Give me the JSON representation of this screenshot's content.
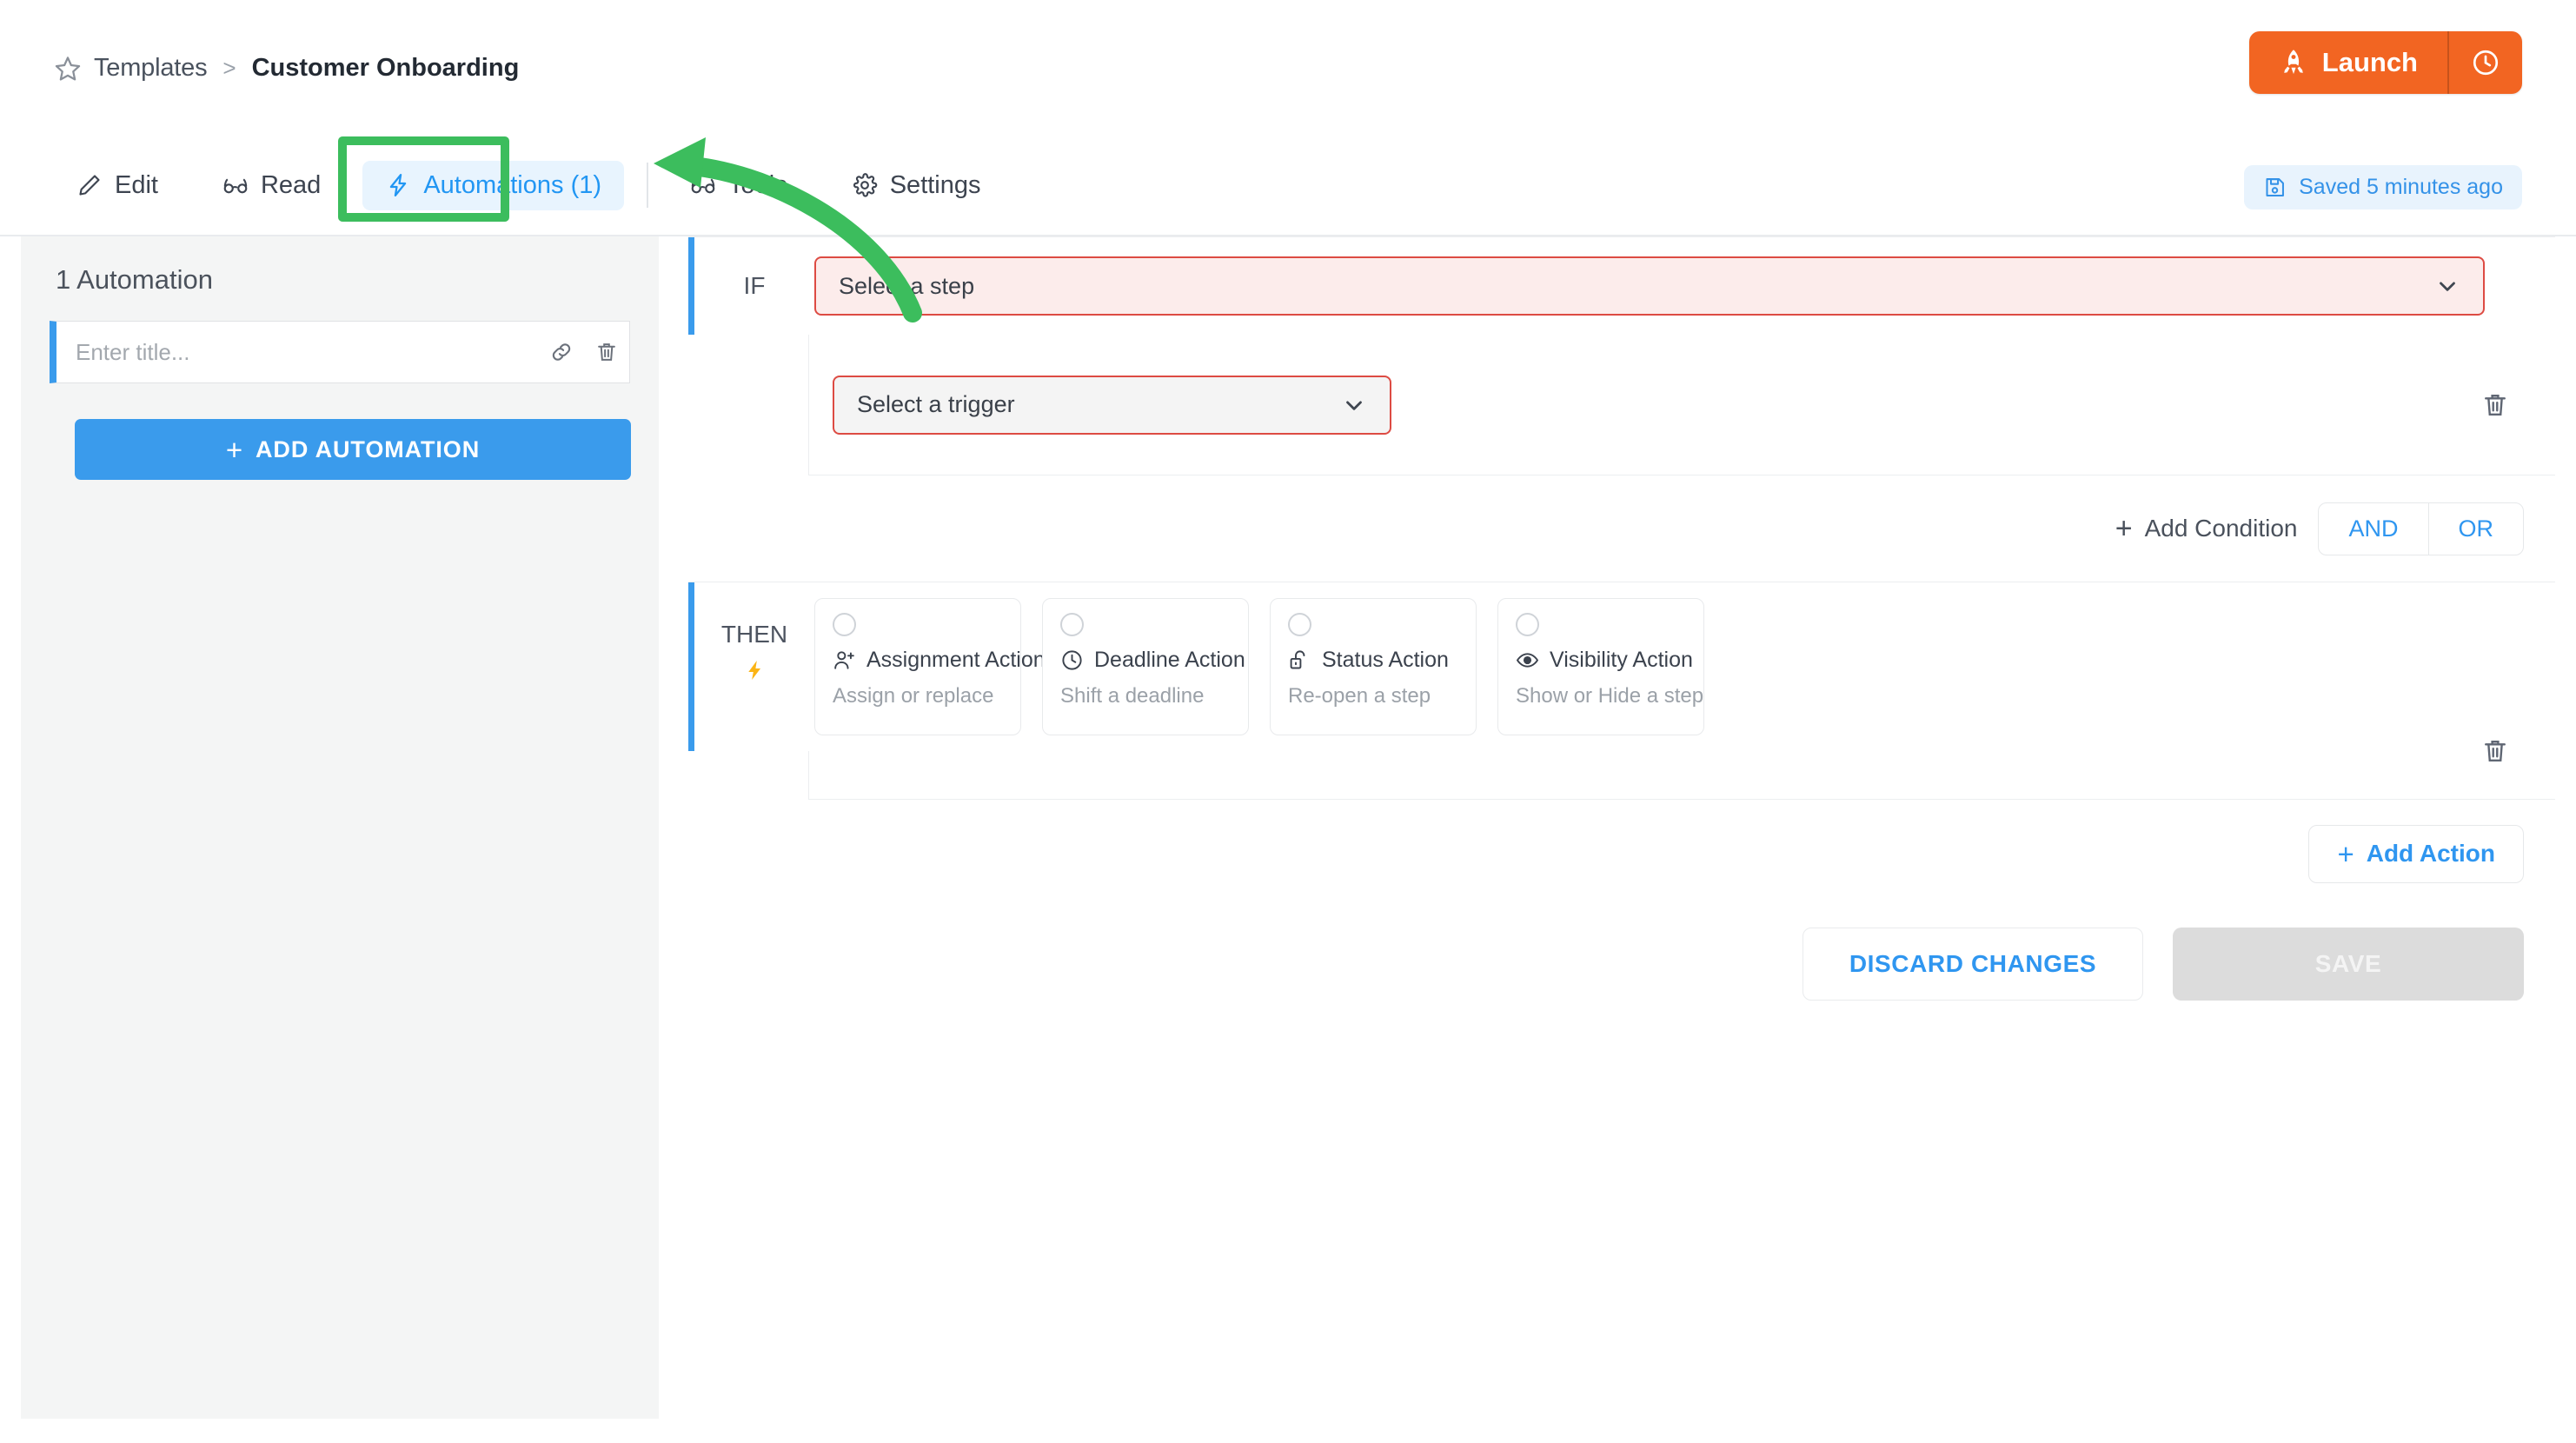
{
  "header": {
    "breadcrumb": {
      "star_icon": "star-icon",
      "root": "Templates",
      "separator": ">",
      "current": "Customer Onboarding"
    },
    "launch": {
      "label": "Launch",
      "rocket_icon": "rocket-icon",
      "clock_icon": "clock-icon",
      "color": "#f26522"
    }
  },
  "tabs": {
    "items": [
      {
        "label": "Edit",
        "icon": "pencil-icon",
        "active": false
      },
      {
        "label": "Read",
        "icon": "glasses-icon",
        "active": false
      },
      {
        "label": "Automations (1)",
        "icon": "bolt-icon",
        "active": true
      },
      {
        "label": "Tools",
        "icon": "glasses-icon",
        "active": false
      },
      {
        "label": "Settings",
        "icon": "gear-icon",
        "active": false
      }
    ],
    "saved_badge": {
      "label": "Saved 5 minutes ago",
      "icon": "save-disk-icon",
      "color": "#3492e8"
    }
  },
  "sidebar": {
    "title": "1 Automation",
    "automation_item": {
      "title_value": "",
      "title_placeholder": "Enter title...",
      "link_icon": "link-icon",
      "delete_icon": "trash-icon",
      "accent_color": "#3a9bec"
    },
    "add_button": {
      "label": "ADD AUTOMATION",
      "plus": "+",
      "color": "#3a9bec"
    }
  },
  "editor": {
    "if": {
      "label": "IF",
      "step_dropdown": {
        "value": "Select a step",
        "error": true,
        "fill": "#fceceb",
        "border": "#dd4b43",
        "chevron_icon": "chevron-down-icon"
      },
      "trigger_dropdown": {
        "value": "Select a trigger",
        "error": true,
        "fill": "#f4f4f4",
        "border": "#dd4b43",
        "chevron_icon": "chevron-down-icon"
      },
      "delete_icon": "trash-icon"
    },
    "condition_row": {
      "add_condition_label": "Add Condition",
      "plus": "+",
      "and_label": "AND",
      "or_label": "OR",
      "accent": "#2f96f0"
    },
    "then": {
      "label": "THEN",
      "bolt_icon": "lightning-bolt-icon",
      "actions": [
        {
          "title": "Assignment Action",
          "subtitle": "Assign or replace",
          "icon": "user-plus-icon",
          "selected": false
        },
        {
          "title": "Deadline Action",
          "subtitle": "Shift a deadline",
          "icon": "clock-icon",
          "selected": false
        },
        {
          "title": "Status Action",
          "subtitle": "Re-open a step",
          "icon": "unlock-icon",
          "selected": false
        },
        {
          "title": "Visibility Action",
          "subtitle": "Show or Hide a step",
          "icon": "eye-icon",
          "selected": false
        }
      ],
      "delete_icon": "trash-icon"
    },
    "add_action_button": {
      "label": "Add Action",
      "plus": "+",
      "color": "#2f96f0"
    },
    "footer": {
      "discard_label": "DISCARD CHANGES",
      "save_label": "SAVE",
      "save_disabled": true
    }
  },
  "annotations": {
    "highlight_box": {
      "color": "#3cbd5d",
      "target": "Automations (1)"
    },
    "arrow": {
      "color": "#3cbd5d",
      "from": "step-dropdown",
      "to": "automations-tab"
    }
  }
}
